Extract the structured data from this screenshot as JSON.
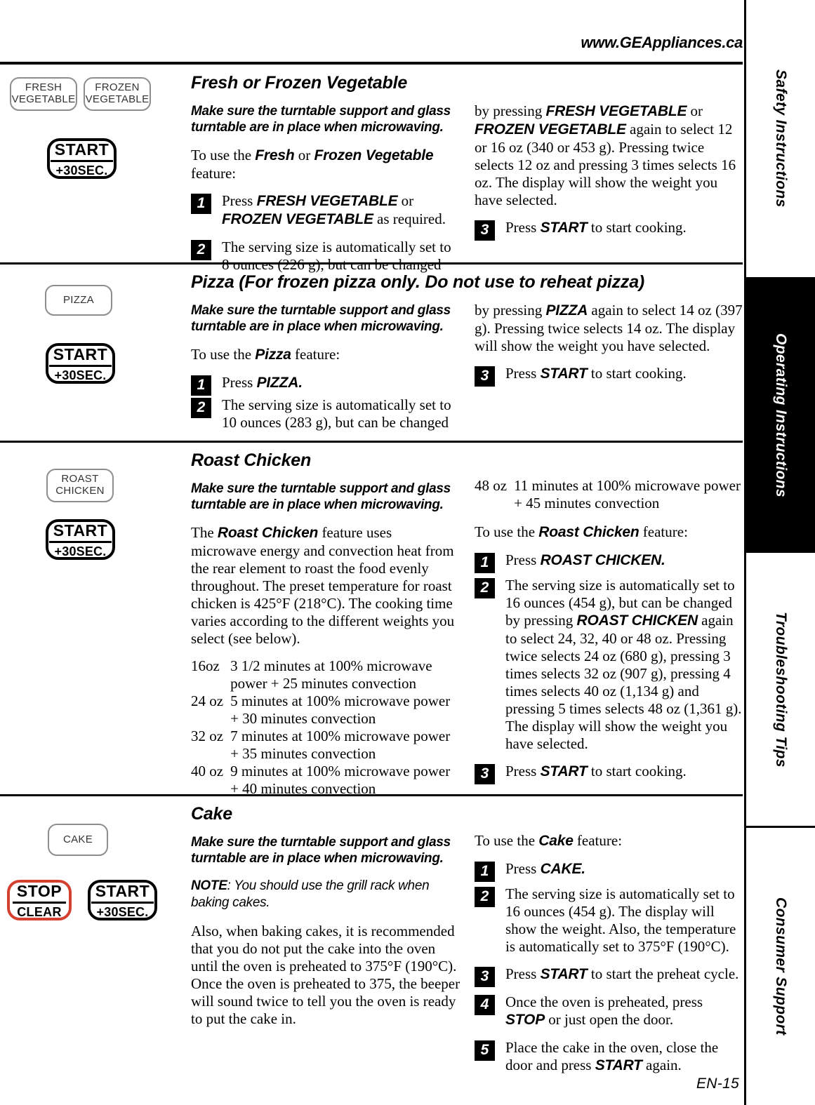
{
  "header": {
    "url": "www.GEAppliances.ca"
  },
  "footer": {
    "page_number": "EN-15"
  },
  "rail": {
    "tabs": [
      {
        "label": "Safety Instructions",
        "active": false
      },
      {
        "label": "Operating Instructions",
        "active": true
      },
      {
        "label": "Troubleshooting Tips",
        "active": false
      },
      {
        "label": "Consumer Support",
        "active": false
      }
    ]
  },
  "common": {
    "turntable_warning": "Make sure the turntable support and glass turntable are in place when microwaving.",
    "start_key": {
      "top": "START",
      "bottom": "+30SEC."
    },
    "stop_key": {
      "top": "STOP",
      "bottom": "CLEAR"
    }
  },
  "sections": [
    {
      "id": "fresh-or-frozen-vegetable",
      "title": "Fresh or Frozen Vegetable",
      "keys": [
        {
          "name": "fresh-vegetable",
          "line1": "FRESH",
          "line2": "VEGETABLE"
        },
        {
          "name": "frozen-vegetable",
          "line1": "FROZEN",
          "line2": "VEGETABLE"
        }
      ],
      "intro": "To use the <b class=\"sans-b\">Fresh</b> or <b class=\"sans-b\">Frozen Vegetable</b> feature:",
      "steps_left": [
        {
          "num": "1",
          "html": "Press <b class=\"sans-b\">FRESH VEGETABLE</b> or <b class=\"sans-b\">FROZEN VEGETABLE</b> as required."
        },
        {
          "num": "2",
          "html": "The serving size is automatically set to 8 ounces (226 g), but can be changed"
        }
      ],
      "right_continuation": "by pressing <b class=\"sans-b\">FRESH VEGETABLE</b> or <b class=\"sans-b\">FROZEN VEGETABLE</b> again to select 12 or 16 oz (340 or 453 g). Pressing twice selects 12 oz and pressing 3 times selects 16 oz. The display will show the weight you have selected.",
      "steps_right": [
        {
          "num": "3",
          "html": "Press <b class=\"sans-b\">START</b> to start cooking."
        }
      ]
    },
    {
      "id": "pizza",
      "title": "Pizza (For frozen pizza only. Do not use to reheat pizza)",
      "keys": [
        {
          "name": "pizza",
          "line1": "PIZZA",
          "line2": ""
        }
      ],
      "intro": "To use the <b class=\"sans-b\">Pizza</b> feature:",
      "steps_left": [
        {
          "num": "1",
          "html": "Press <b class=\"sans-b\">PIZZA.</b>"
        },
        {
          "num": "2",
          "html": "The serving size is automatically set to 10 ounces (283 g), but can be changed"
        }
      ],
      "right_continuation": "by pressing <b class=\"sans-b\">PIZZA</b> again to select 14 oz (397 g). Pressing twice selects 14 oz. The display will show the weight you have selected.",
      "steps_right": [
        {
          "num": "3",
          "html": "Press <b class=\"sans-b\">START</b> to start cooking."
        }
      ]
    },
    {
      "id": "roast-chicken",
      "title": "Roast Chicken",
      "keys": [
        {
          "name": "roast-chicken",
          "line1": "ROAST",
          "line2": "CHICKEN"
        }
      ],
      "description": "The <b class=\"sans-b\">Roast Chicken</b> feature uses microwave energy and convection heat from the rear element to roast the food evenly throughout. The preset temperature for roast chicken is 425&deg;F (218&deg;C). The cooking time varies according to the different weights you select (see below).",
      "weight_table_left": [
        {
          "weight": "16oz",
          "time": "3 1/2 minutes at 100% microwave power + 25 minutes convection"
        },
        {
          "weight": "24 oz",
          "time": "5 minutes at 100% microwave power + 30 minutes convection"
        },
        {
          "weight": "32 oz",
          "time": "7 minutes at 100% microwave power + 35 minutes convection"
        },
        {
          "weight": "40 oz",
          "time": "9 minutes at 100% microwave power + 40 minutes convection"
        }
      ],
      "weight_table_right": [
        {
          "weight": "48 oz",
          "time": "11 minutes at 100% microwave power + 45 minutes convection"
        }
      ],
      "intro": "To use the <b class=\"sans-b\">Roast Chicken</b> feature:",
      "steps_right": [
        {
          "num": "1",
          "html": "Press <b class=\"sans-b\">ROAST CHICKEN.</b>"
        },
        {
          "num": "2",
          "html": "The serving size is automatically set to 16 ounces (454 g), but can be changed by pressing <b class=\"sans-b\">ROAST CHICKEN</b> again to select 24, 32, 40 or 48 oz. Pressing twice selects 24 oz (680 g), pressing 3 times selects 32 oz (907 g), pressing 4 times selects 40 oz (1,134 g) and pressing 5 times selects 48 oz (1,361 g). The display will show the weight you have selected."
        },
        {
          "num": "3",
          "html": "Press <b class=\"sans-b\">START</b> to start cooking."
        }
      ]
    },
    {
      "id": "cake",
      "title": "Cake",
      "keys": [
        {
          "name": "cake",
          "line1": "CAKE",
          "line2": ""
        }
      ],
      "note": "<b>NOTE</b>: You should use the grill rack when baking cakes.",
      "description": "Also, when baking cakes, it is recommended that you do not put the cake into the oven until the oven is preheated to 375&deg;F (190&deg;C). Once the oven is preheated to 375, the beeper will sound twice to tell you the oven is ready to put the cake in.",
      "intro": "To use the <b class=\"sans-b\">Cake</b> feature:",
      "steps_right": [
        {
          "num": "1",
          "html": "Press <b class=\"sans-b\">CAKE.</b>"
        },
        {
          "num": "2",
          "html": "The serving size is automatically set to 16 ounces (454 g). The display will show the weight. Also, the temperature is automatically set to 375&deg;F (190&deg;C)."
        },
        {
          "num": "3",
          "html": "Press <b class=\"sans-b\">START</b> to start the preheat cycle."
        },
        {
          "num": "4",
          "html": "Once the oven is preheated, press <b class=\"sans-b\">STOP</b> or just open the door."
        },
        {
          "num": "5",
          "html": "Place the cake in the oven, close the door and press <b class=\"sans-b\">START</b> again."
        }
      ]
    }
  ]
}
